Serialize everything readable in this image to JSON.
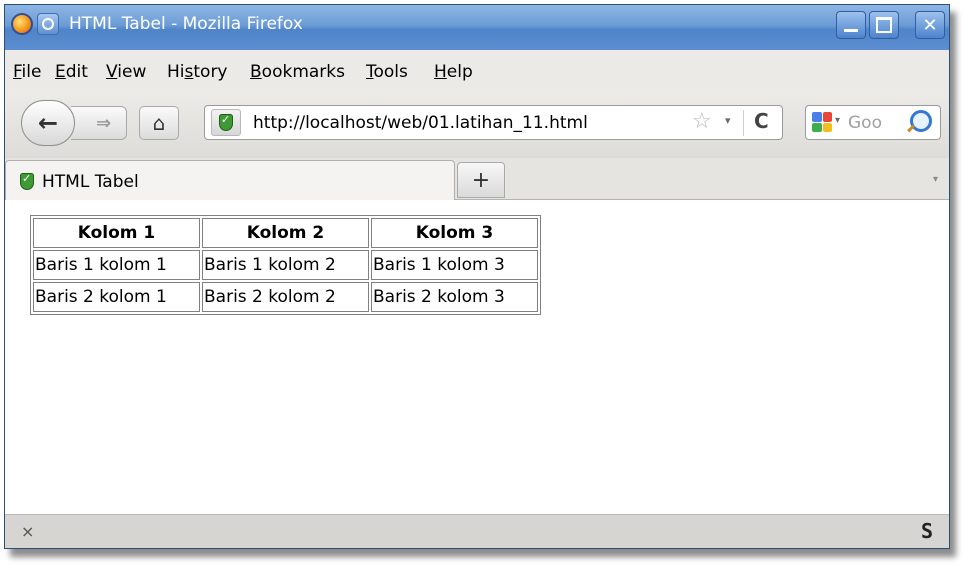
{
  "window": {
    "title": "HTML Tabel - Mozilla Firefox",
    "controls": [
      "minimize",
      "maximize",
      "close"
    ]
  },
  "menubar": {
    "items": [
      {
        "pre": "",
        "key": "F",
        "post": "ile"
      },
      {
        "pre": "",
        "key": "E",
        "post": "dit"
      },
      {
        "pre": "",
        "key": "V",
        "post": "iew"
      },
      {
        "pre": "Hi",
        "key": "s",
        "post": "tory"
      },
      {
        "pre": "",
        "key": "B",
        "post": "ookmarks"
      },
      {
        "pre": "",
        "key": "T",
        "post": "ools"
      },
      {
        "pre": "",
        "key": "H",
        "post": "elp"
      }
    ]
  },
  "navbar": {
    "back_icon": "←",
    "forward_icon": "⇒",
    "home_icon": "⌂",
    "url": "http://localhost/web/01.latihan_11.html",
    "bookmark_icon": "☆",
    "dropdown_icon": "▾",
    "reload_icon": "C",
    "search_placeholder": "Goo"
  },
  "tabs": {
    "items": [
      {
        "label": "HTML Tabel"
      }
    ],
    "new_tab_icon": "+",
    "list_icon": "▾"
  },
  "content": {
    "table": {
      "headers": [
        "Kolom 1",
        "Kolom 2",
        "Kolom 3"
      ],
      "rows": [
        [
          "Baris 1 kolom 1",
          "Baris 1 kolom 2",
          "Baris 1 kolom 3"
        ],
        [
          "Baris 2 kolom 1",
          "Baris 2 kolom 2",
          "Baris 2 kolom 3"
        ]
      ]
    }
  },
  "statusbar": {
    "close_icon": "×",
    "addon_icon": "S"
  },
  "colors": {
    "titlebar": "#5c8ed0",
    "chrome": "#eceae6",
    "table_border": "#808080",
    "search_icon": "#3478d6"
  }
}
